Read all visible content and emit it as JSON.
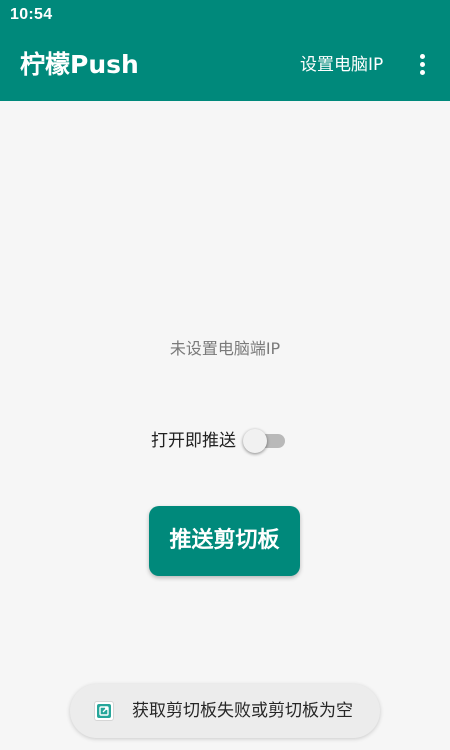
{
  "status_bar": {
    "time": "10:54"
  },
  "app_bar": {
    "title": "柠檬Push",
    "set_ip_action": "设置电脑IP",
    "overflow_icon": "more-vertical-icon"
  },
  "main": {
    "ip_status": "未设置电脑端IP",
    "auto_push_label": "打开即推送",
    "auto_push_enabled": false,
    "push_button_label": "推送剪切板"
  },
  "toast": {
    "icon": "app-icon",
    "message": "获取剪切板失败或剪切板为空"
  },
  "colors": {
    "primary": "#00897b",
    "background": "#f6f6f6",
    "switch_track_off": "#b9b9b9",
    "switch_thumb_off": "#f1f1f1"
  }
}
